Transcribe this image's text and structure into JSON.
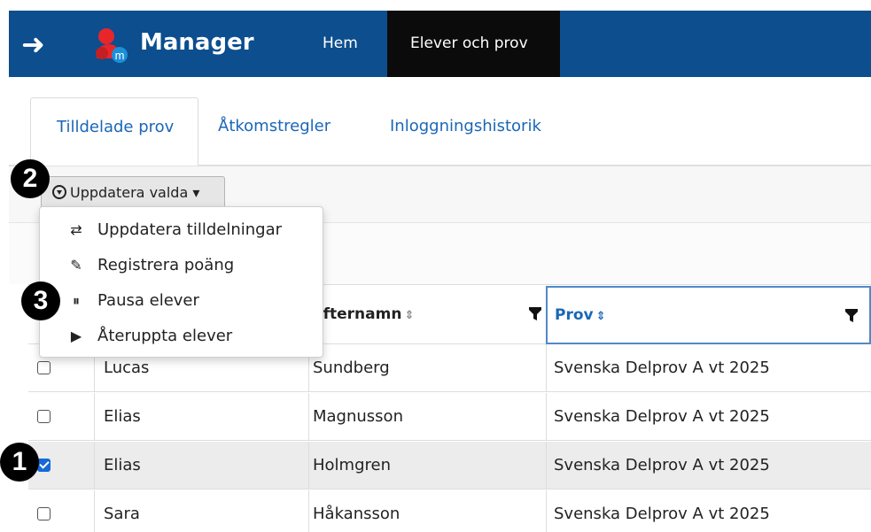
{
  "navbar": {
    "brand": "Manager",
    "logo_letter": "m",
    "items": [
      "Hem",
      "Elever och prov"
    ],
    "bg": "#0c4e8e"
  },
  "tabs": [
    "Tilldelade prov",
    "Åtkomstregler",
    "Inloggningshistorik"
  ],
  "toolbar": {
    "dropdown_label": "Uppdatera valda ▾"
  },
  "menu": {
    "items": [
      {
        "icon": "⇄",
        "label": "Uppdatera tilldelningar"
      },
      {
        "icon": "✎",
        "label": "Registrera poäng"
      },
      {
        "icon": "⏸",
        "label": "Pausa elever"
      },
      {
        "icon": "▶",
        "label": "Återuppta elever"
      }
    ]
  },
  "table": {
    "headers": {
      "lastname": "Efternamn",
      "test": "Prov",
      "sort_glyph": "⇕"
    },
    "rows": [
      {
        "checked": false,
        "first": "Lucas",
        "last": "Sundberg",
        "test": "Svenska Delprov A vt 2025"
      },
      {
        "checked": false,
        "first": "Elias",
        "last": "Magnusson",
        "test": "Svenska Delprov A vt 2025"
      },
      {
        "checked": true,
        "first": "Elias",
        "last": "Holmgren",
        "test": "Svenska Delprov A vt 2025"
      },
      {
        "checked": false,
        "first": "Sara",
        "last": "Håkansson",
        "test": "Svenska Delprov A vt 2025"
      }
    ]
  },
  "badges": [
    "1",
    "2",
    "3"
  ]
}
